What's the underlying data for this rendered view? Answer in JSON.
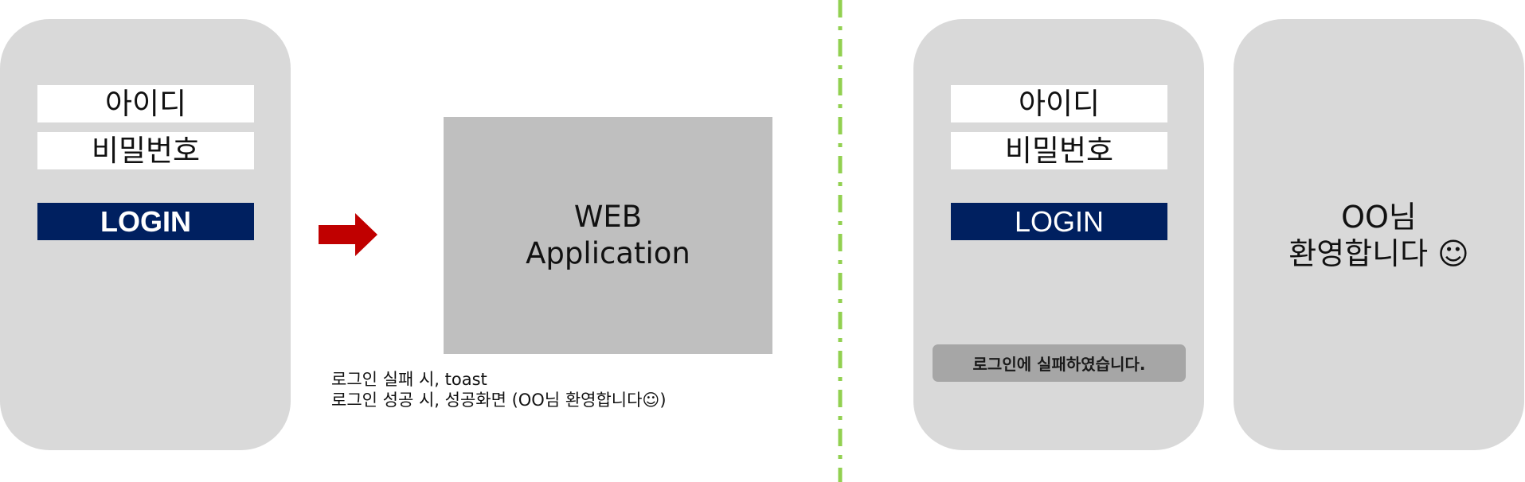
{
  "login_screen": {
    "id_label": "아이디",
    "password_label": "비밀번호",
    "login_button": "LOGIN"
  },
  "arrow": {
    "icon": "right-arrow-icon",
    "color": "#c00000"
  },
  "web_app": {
    "line1": "WEB",
    "line2": "Application"
  },
  "caption": {
    "line1": "로그인 실패 시, toast",
    "line2": "로그인 성공 시, 성공화면 (OO님 환영합니다☺)"
  },
  "failure_screen": {
    "id_label": "아이디",
    "password_label": "비밀번호",
    "login_button": "LOGIN",
    "toast_message": "로그인에 실패하였습니다."
  },
  "success_screen": {
    "line1": "OO님",
    "line2": "환영합니다 ☺"
  },
  "colors": {
    "phone_bg": "#d9d9d9",
    "login_button": "#002060",
    "web_app_box": "#bfbfbf",
    "toast_bg": "#a6a6a6",
    "divider": "#92d050"
  }
}
